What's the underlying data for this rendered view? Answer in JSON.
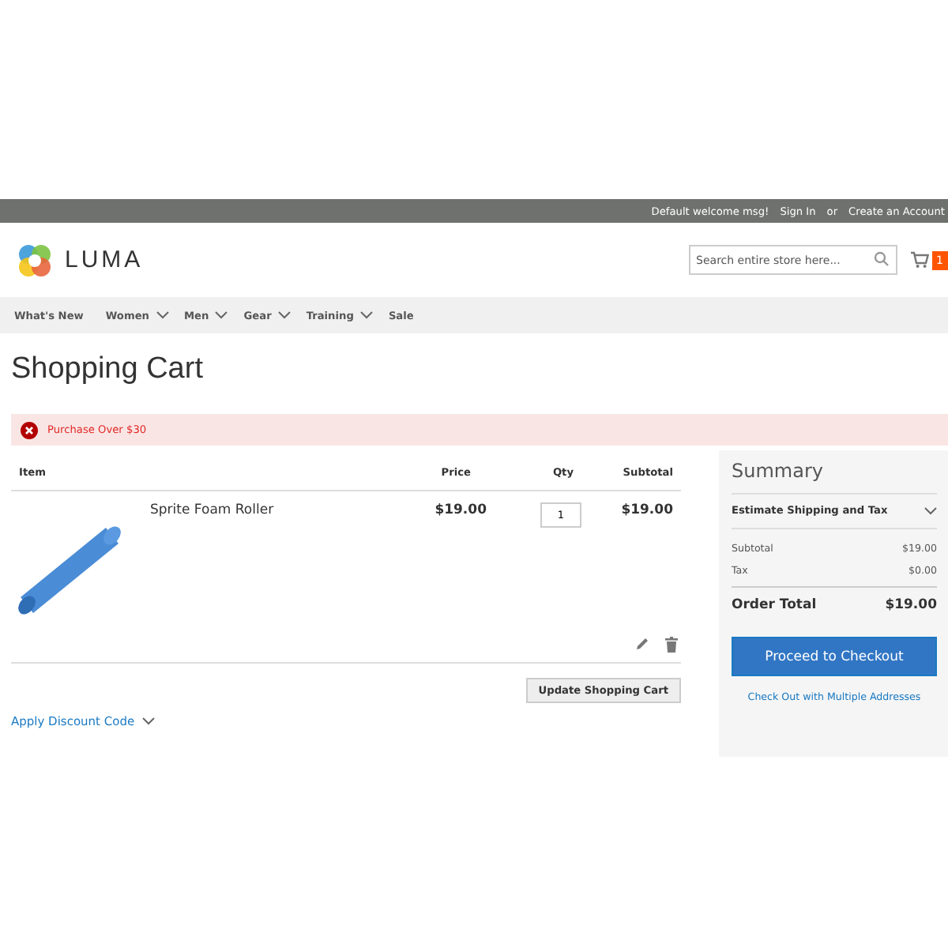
{
  "top_bar": {
    "welcome": "Default welcome msg!",
    "sign_in": "Sign In",
    "or": "or",
    "create_account": "Create an Account"
  },
  "header": {
    "logo_text": "LUMA",
    "search": {
      "placeholder": "Search entire store here..."
    },
    "cart_count": "1"
  },
  "nav": [
    {
      "label": "What's New",
      "dropdown": false
    },
    {
      "label": "Women",
      "dropdown": true
    },
    {
      "label": "Men",
      "dropdown": true
    },
    {
      "label": "Gear",
      "dropdown": true
    },
    {
      "label": "Training",
      "dropdown": true
    },
    {
      "label": "Sale",
      "dropdown": false
    }
  ],
  "page_title": "Shopping Cart",
  "message": {
    "kind": "error",
    "text": "Purchase Over $30"
  },
  "cart": {
    "columns": [
      "Item",
      "Price",
      "Qty",
      "Subtotal"
    ],
    "rows": [
      {
        "name": "Sprite Foam Roller",
        "price": "$19.00",
        "qty": "1",
        "subtotal": "$19.00"
      }
    ],
    "update_button": "Update Shopping Cart",
    "discount_link": "Apply Discount Code"
  },
  "summary": {
    "title": "Summary",
    "estimate": "Estimate Shipping and Tax",
    "lines": [
      {
        "label": "Subtotal",
        "value": "$19.00"
      },
      {
        "label": "Tax",
        "value": "$0.00"
      }
    ],
    "total_label": "Order Total",
    "total_value": "$19.00",
    "checkout_button": "Proceed to Checkout",
    "multi_link": "Check Out with Multiple Addresses"
  }
}
